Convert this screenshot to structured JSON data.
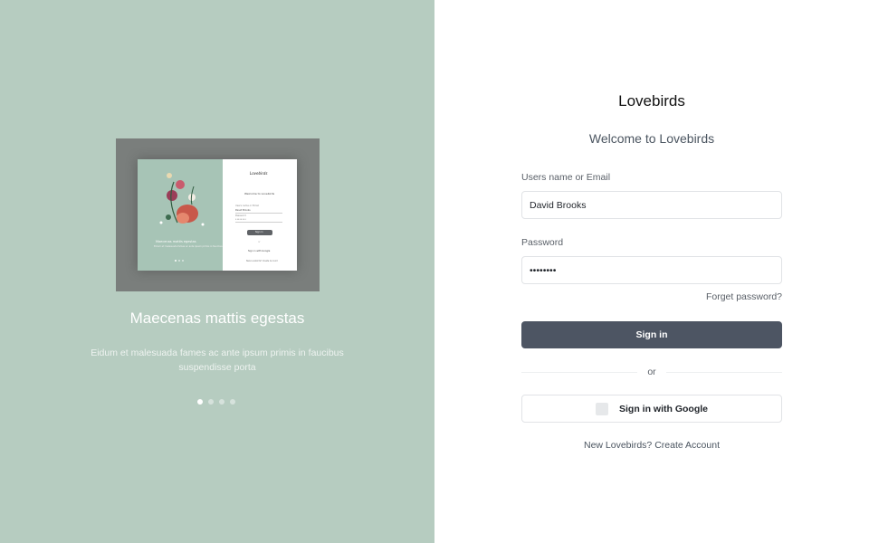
{
  "left_panel": {
    "preview": {
      "brand": "Lovebirds",
      "welcome": "Welcome to Lovebirds",
      "username_label": "Users name or Email",
      "username_value": "David Brooks",
      "password_label": "Password",
      "password_value": "••••••••",
      "signin_label": "Sign in",
      "or": "or",
      "google_label": "Sign in with Google",
      "create": "New Lovebirds? Create Account",
      "slide_title": "Maecenas mattis egestas",
      "slide_text": "Eidum et malesuada fames ac ante ipsum primis in faucibus"
    },
    "slide_title": "Maecenas mattis egestas",
    "slide_text": "Eidum et malesuada fames ac ante ipsum primis in faucibus suspendisse porta",
    "dots_count": 4,
    "active_dot": 1
  },
  "login": {
    "brand": "Lovebirds",
    "welcome": "Welcome to Lovebirds",
    "username_label": "Users name or Email",
    "username_value": "David Brooks",
    "password_label": "Password",
    "password_value": "12345678",
    "forgot": "Forget password?",
    "signin_label": "Sign in",
    "or": "or",
    "google_label": "Sign in with Google",
    "create_prefix": "New Lovebirds?",
    "create_link": "Create Account"
  },
  "colors": {
    "left_bg": "#b6ccc0",
    "button_bg": "#4d5563"
  }
}
